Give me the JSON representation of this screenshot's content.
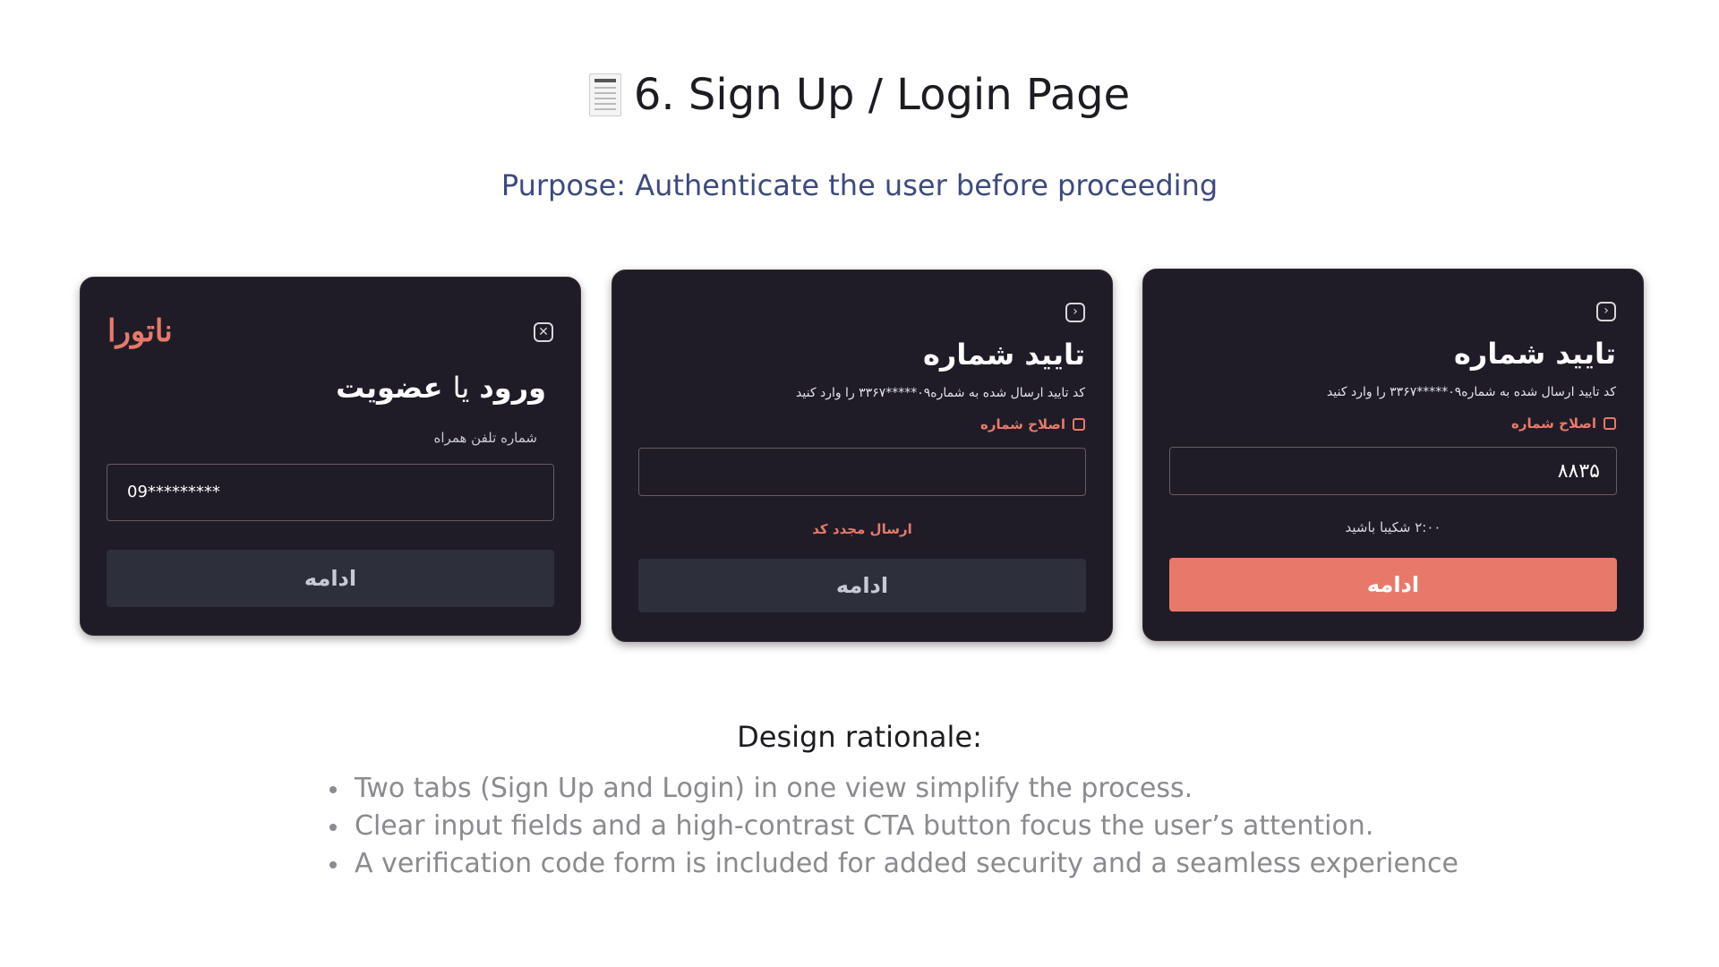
{
  "header": {
    "title": "6. Sign Up / Login Page",
    "icon": "receipt-icon",
    "subtitle": "Purpose: Authenticate the user before proceeding"
  },
  "colors": {
    "card_bg": "#1f1c27",
    "accent": "#e8796a",
    "button_disabled": "#2d303b",
    "subtitle": "#3d4a7e"
  },
  "login_card": {
    "logo": "ناتورا",
    "heading_bold_1": "ورود",
    "heading_light": "یا",
    "heading_bold_2": "عضویت",
    "phone_label": "شماره تلفن همراه",
    "phone_value": "09*********",
    "continue_label": "ادامه"
  },
  "verify_card_empty": {
    "heading": "تایید شماره",
    "description": "کد تایید ارسال شده به شماره۰۹*****۳۳۶۷ را وارد کنید",
    "edit_label": "اصلاح شماره",
    "code_value": "",
    "resend_label": "ارسال مجدد کد",
    "continue_label": "ادامه"
  },
  "verify_card_filled": {
    "heading": "تایید شماره",
    "description": "کد تایید ارسال شده به شماره۰۹*****۳۳۶۷ را وارد کنید",
    "edit_label": "اصلاح شماره",
    "code_value": "۸۸۳۵",
    "timer_label": "۲:۰۰ شکیبا باشید",
    "continue_label": "ادامه"
  },
  "rationale": {
    "title": "Design rationale:",
    "items": [
      "Two tabs (Sign Up and Login) in one view simplify the process.",
      "Clear input fields and a high-contrast CTA button focus the user’s attention.",
      "A verification code form is included for added security and a seamless experience"
    ]
  }
}
